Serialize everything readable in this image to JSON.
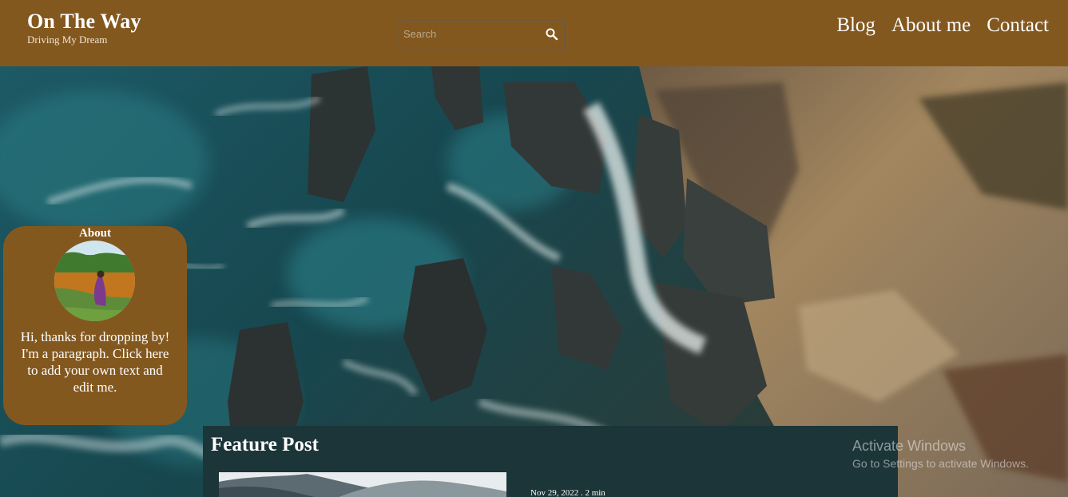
{
  "header": {
    "brand_title": "On The Way",
    "brand_tagline": "Driving My Dream",
    "search_placeholder": "Search",
    "nav": [
      "Blog",
      "About me",
      "Contact"
    ]
  },
  "about": {
    "title": "About",
    "text_line1": "Hi, thanks for dropping by!",
    "text_line2": "I'm a paragraph. Click here to add your own text and edit me."
  },
  "feature": {
    "title": "Feature Post",
    "meta": "Nov 29, 2022 . 2 min"
  },
  "watermark": {
    "title": "Activate Windows",
    "subtitle": "Go to Settings to activate Windows."
  },
  "colors": {
    "header_bg": "#83581f",
    "card_bg": "#83581f",
    "feature_bg": "#1c3539"
  },
  "icons": [
    "search-icon"
  ]
}
